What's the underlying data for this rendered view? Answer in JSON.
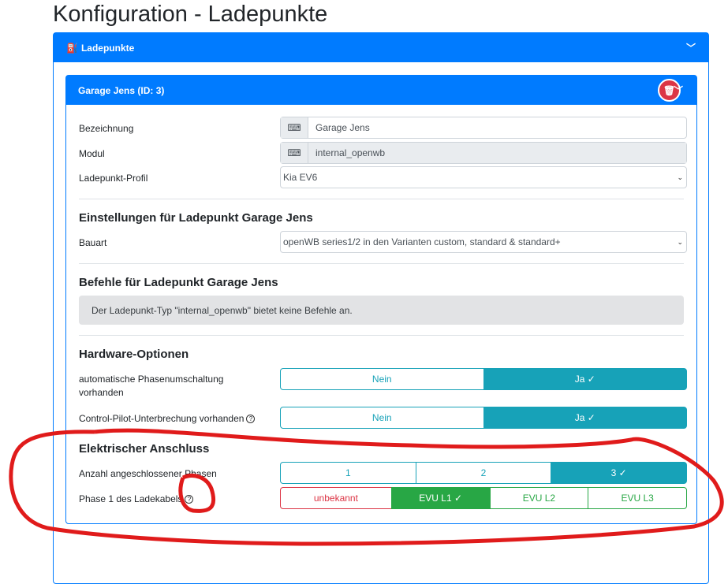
{
  "page_title": "Konfiguration - Ladepunkte",
  "section": {
    "title": "Ladepunkte"
  },
  "chargepoint": {
    "title": "Garage Jens (ID: 3)",
    "bezeichnung_label": "Bezeichnung",
    "bezeichnung_value": "Garage Jens",
    "modul_label": "Modul",
    "modul_value": "internal_openwb",
    "profil_label": "Ladepunkt-Profil",
    "profil_value": "Kia EV6",
    "settings_heading": "Einstellungen für Ladepunkt Garage Jens",
    "bauart_label": "Bauart",
    "bauart_value": "openWB series1/2 in den Varianten custom, standard & standard+",
    "commands_heading": "Befehle für Ladepunkt Garage Jens",
    "commands_info": "Der Ladepunkt-Typ \"internal_openwb\" bietet keine Befehle an.",
    "hardware_heading": "Hardware-Optionen",
    "phase_switch_label": "automatische Phasenumschaltung vorhanden",
    "cp_interrupt_label": "Control-Pilot-Unterbrechung vorhanden",
    "no": "Nein",
    "yes": "Ja ✓",
    "electrical_heading": "Elektrischer Anschluss",
    "phases_label": "Anzahl angeschlossener Phasen",
    "phases_options": [
      "1",
      "2",
      "3 ✓"
    ],
    "phase1_label": "Phase 1 des Ladekabels",
    "phase1_options": [
      "unbekannt",
      "EVU L1 ✓",
      "EVU L2",
      "EVU L3"
    ]
  }
}
